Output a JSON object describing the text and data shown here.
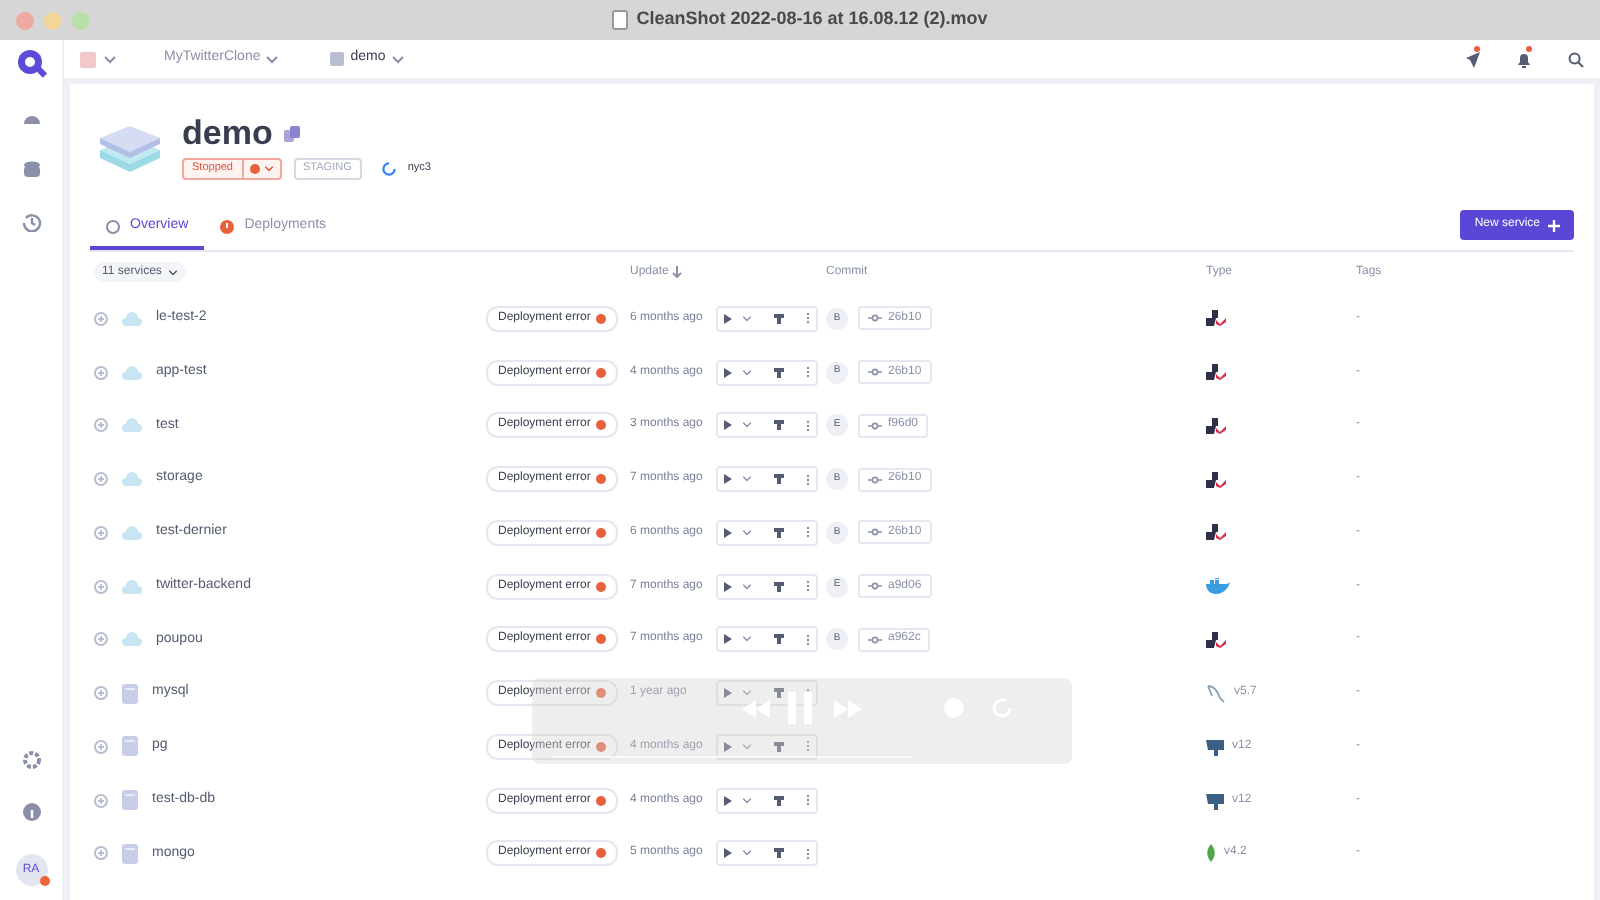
{
  "window": {
    "title": "CleanShot 2022-08-16 at 16.08.12 (2).mov"
  },
  "breadcrumbs": [
    {
      "label": "MyTwitterClone"
    },
    {
      "label": "demo"
    }
  ],
  "environment": {
    "name": "demo",
    "status": "Stopped",
    "mode": "STAGING",
    "cluster": "nyc3"
  },
  "tabs": [
    {
      "label": "Overview",
      "selected": true,
      "error": false
    },
    {
      "label": "Deployments",
      "selected": false,
      "error": true
    }
  ],
  "new_service_button": "New service",
  "table": {
    "filter": "11 services",
    "columns": [
      "Update",
      "Commit",
      "Type",
      "Tags"
    ],
    "rows": [
      {
        "name": "le-test-2",
        "kind": "app",
        "status": "Deployment error",
        "updated": "6 months ago",
        "author": "B",
        "commit": "26b10",
        "version": "",
        "tags": "-"
      },
      {
        "name": "app-test",
        "kind": "app",
        "status": "Deployment error",
        "updated": "4 months ago",
        "author": "B",
        "commit": "26b10",
        "version": "",
        "tags": "-"
      },
      {
        "name": "test",
        "kind": "app",
        "status": "Deployment error",
        "updated": "3 months ago",
        "author": "E",
        "commit": "f96d0",
        "version": "",
        "tags": "-"
      },
      {
        "name": "storage",
        "kind": "app",
        "status": "Deployment error",
        "updated": "7 months ago",
        "author": "B",
        "commit": "26b10",
        "version": "",
        "tags": "-"
      },
      {
        "name": "test-dernier",
        "kind": "app",
        "status": "Deployment error",
        "updated": "6 months ago",
        "author": "B",
        "commit": "26b10",
        "version": "",
        "tags": "-"
      },
      {
        "name": "twitter-backend",
        "kind": "docker",
        "status": "Deployment error",
        "updated": "7 months ago",
        "author": "E",
        "commit": "a9d06",
        "version": "",
        "tags": "-"
      },
      {
        "name": "poupou",
        "kind": "app",
        "status": "Deployment error",
        "updated": "7 months ago",
        "author": "B",
        "commit": "a962c",
        "version": "",
        "tags": "-"
      },
      {
        "name": "mysql",
        "kind": "mysql",
        "status": "Deployment error",
        "updated": "1 year ago",
        "version": "v5.7",
        "tags": "-"
      },
      {
        "name": "pg",
        "kind": "postgresql",
        "status": "Deployment error",
        "updated": "4 months ago",
        "version": "v12",
        "tags": "-"
      },
      {
        "name": "test-db-db",
        "kind": "postgresql",
        "status": "Deployment error",
        "updated": "4 months ago",
        "version": "v12",
        "tags": "-"
      },
      {
        "name": "mongo",
        "kind": "mongodb",
        "status": "Deployment error",
        "updated": "5 months ago",
        "version": "v4.2",
        "tags": "-"
      }
    ]
  },
  "user": {
    "initials": "RA"
  }
}
